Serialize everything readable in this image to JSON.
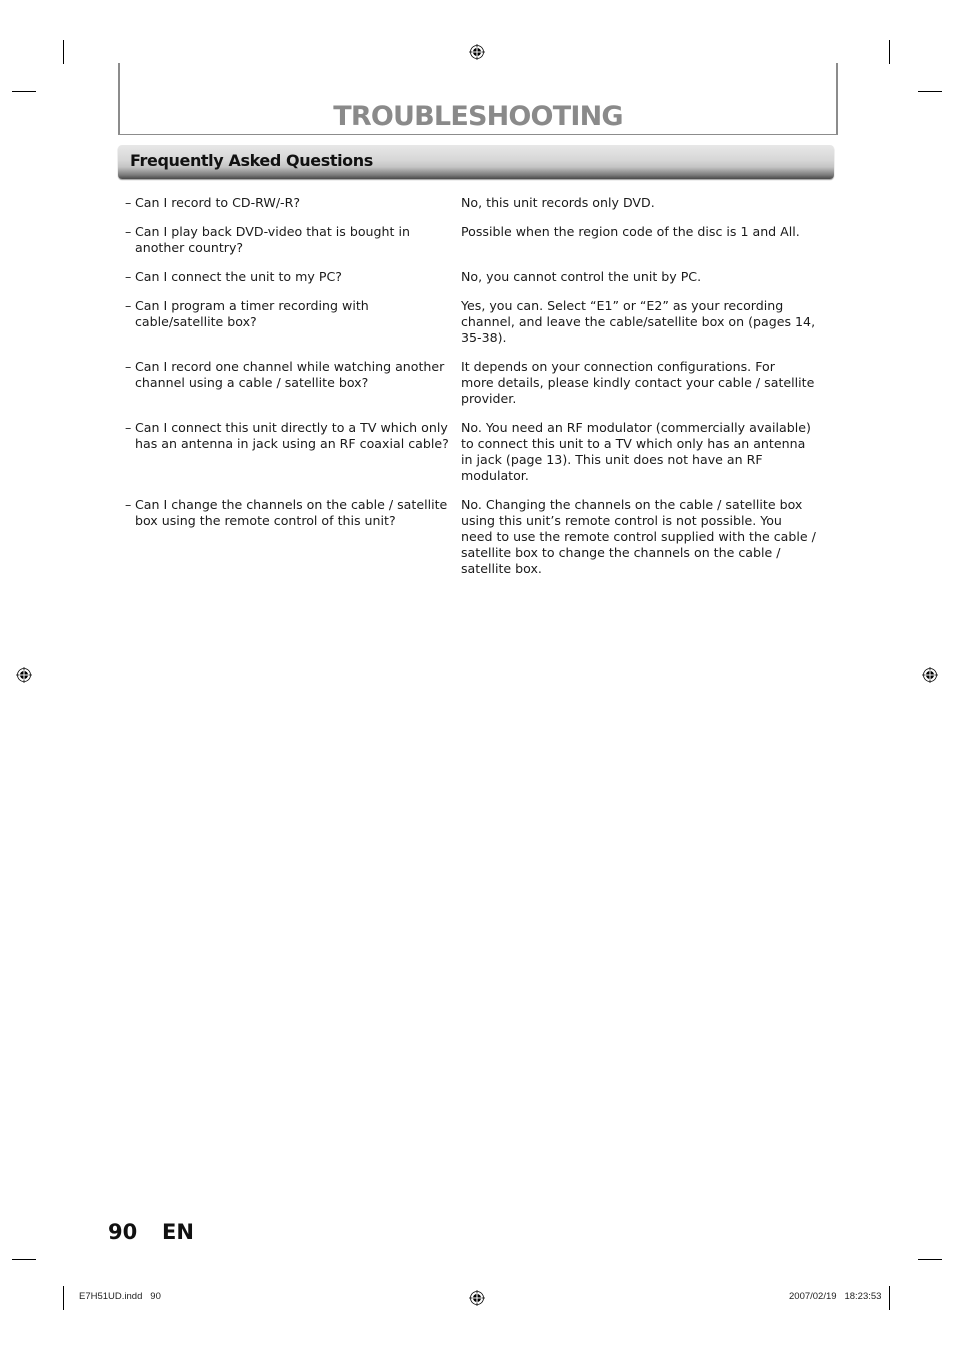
{
  "header": {
    "title": "TROUBLESHOOTING",
    "section_title": "Frequently Asked Questions"
  },
  "faq": [
    {
      "question": "Can I record to CD-RW/-R?",
      "answer": "No, this unit records only DVD."
    },
    {
      "question": "Can I play back DVD-video that is bought in another country?",
      "answer": "Possible when the region code of the disc is 1 and All."
    },
    {
      "question": "Can I connect the unit to my PC?",
      "answer": "No, you cannot control the unit by PC."
    },
    {
      "question": "Can I program a timer recording with cable/satellite box?",
      "answer": "Yes, you can. Select “E1” or “E2” as your recording channel, and leave the cable/satellite box on (pages 14, 35-38)."
    },
    {
      "question": "Can I record one channel while watching another channel using a cable / satellite box?",
      "answer": "It depends on your connection configurations. For\nmore details, please kindly contact your cable / satellite provider."
    },
    {
      "question": "Can I connect this unit directly to a TV which only has an antenna in jack using an RF coaxial cable?",
      "answer": "No. You need an RF modulator (commercially available) to connect this unit to a TV which only has an antenna in jack (page 13). This unit does not have an RF modulator."
    },
    {
      "question": "Can I change the channels on the cable / satellite box using the remote control of this unit?",
      "answer": "No. Changing the channels on the cable / satellite box using this unit’s remote control is not possible. You\nneed to use the remote control supplied with the cable / satellite box to change the channels on the cable / satellite box."
    }
  ],
  "footer": {
    "page_number": "90",
    "language": "EN",
    "file_name": "E7H51UD.indd   90",
    "timestamp": "2007/02/19   18:23:53"
  },
  "icons": {
    "registration_mark": "registration-target-icon",
    "dash": "–"
  }
}
